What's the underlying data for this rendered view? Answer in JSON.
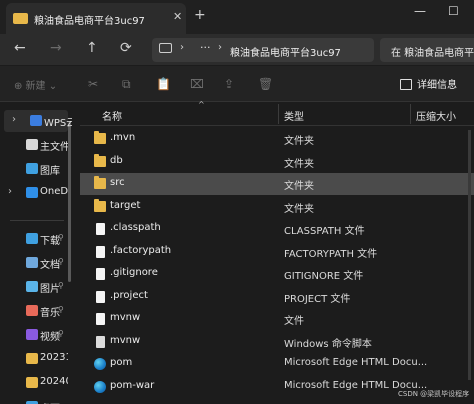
{
  "window": {
    "tab_title": "粮油食品电商平台3uc97",
    "tab_close": "✕",
    "new_tab": "+",
    "minimize": "—",
    "maximize": "☐"
  },
  "nav": {
    "back": "←",
    "forward": "→",
    "up": "↑",
    "refresh": "⟳",
    "address_dots": "···",
    "address_path": "粮油食品电商平台3uc97",
    "search_text": "在 粮油食品电商平台3u"
  },
  "command_bar": {
    "new_label": "⊕ 新建 ⌄",
    "details_label": "详细信息"
  },
  "sidebar": {
    "items": [
      {
        "label": "WPS云",
        "chevron": "›",
        "icon": "wps-cloud-icon",
        "color": "#3b7de0",
        "selected": true
      },
      {
        "label": "主文件",
        "chevron": "",
        "icon": "home-icon",
        "color": "#d9d9d9",
        "selected": false
      },
      {
        "label": "图库",
        "chevron": "",
        "icon": "gallery-icon",
        "color": "#3fa0e0",
        "selected": false
      },
      {
        "label": "OneD",
        "chevron": "›",
        "icon": "onedrive-icon",
        "color": "#2f8fe8",
        "selected": false
      },
      {
        "label": "下载",
        "chevron": "",
        "icon": "download-icon",
        "color": "#3fa0e0",
        "selected": false,
        "pinned": true
      },
      {
        "label": "文档",
        "chevron": "",
        "icon": "documents-icon",
        "color": "#6fa8dc",
        "selected": false,
        "pinned": true
      },
      {
        "label": "图片",
        "chevron": "",
        "icon": "pictures-icon",
        "color": "#5ab4e8",
        "selected": false,
        "pinned": true
      },
      {
        "label": "音乐",
        "chevron": "",
        "icon": "music-icon",
        "color": "#e86a5a",
        "selected": false,
        "pinned": true
      },
      {
        "label": "视频",
        "chevron": "",
        "icon": "videos-icon",
        "color": "#8a5ae0",
        "selected": false,
        "pinned": true
      },
      {
        "label": "20231",
        "chevron": "",
        "icon": "folder-icon",
        "color": "#e8b84a",
        "selected": false
      },
      {
        "label": "20240",
        "chevron": "",
        "icon": "folder-icon",
        "color": "#e8b84a",
        "selected": false
      },
      {
        "label": "桌面",
        "chevron": "",
        "icon": "desktop-icon",
        "color": "#3fa0e0",
        "selected": false
      }
    ],
    "pin_glyph": "📌"
  },
  "columns": {
    "name": "名称",
    "type": "类型",
    "size": "压缩大小"
  },
  "files": [
    {
      "name": ".mvn",
      "type": "文件夹",
      "icon": "folder-icon",
      "kind": "folder"
    },
    {
      "name": "db",
      "type": "文件夹",
      "icon": "folder-icon",
      "kind": "folder"
    },
    {
      "name": "src",
      "type": "文件夹",
      "icon": "folder-icon",
      "kind": "folder",
      "selected": true
    },
    {
      "name": "target",
      "type": "文件夹",
      "icon": "folder-icon",
      "kind": "folder"
    },
    {
      "name": ".classpath",
      "type": "CLASSPATH 文件",
      "icon": "file-icon",
      "kind": "file"
    },
    {
      "name": ".factorypath",
      "type": "FACTORYPATH 文件",
      "icon": "file-icon",
      "kind": "file"
    },
    {
      "name": ".gitignore",
      "type": "GITIGNORE 文件",
      "icon": "file-icon",
      "kind": "file"
    },
    {
      "name": ".project",
      "type": "PROJECT 文件",
      "icon": "file-icon",
      "kind": "file"
    },
    {
      "name": "mvnw",
      "type": "文件",
      "icon": "file-icon",
      "kind": "file"
    },
    {
      "name": "mvnw",
      "type": "Windows 命令脚本",
      "icon": "script-file-icon",
      "kind": "file-dark"
    },
    {
      "name": "pom",
      "type": "Microsoft Edge HTML Docu...",
      "icon": "edge-icon",
      "kind": "edge"
    },
    {
      "name": "pom-war",
      "type": "Microsoft Edge HTML Docu...",
      "icon": "edge-icon",
      "kind": "edge"
    }
  ],
  "watermark": "CSDN @梁凯毕设程序"
}
